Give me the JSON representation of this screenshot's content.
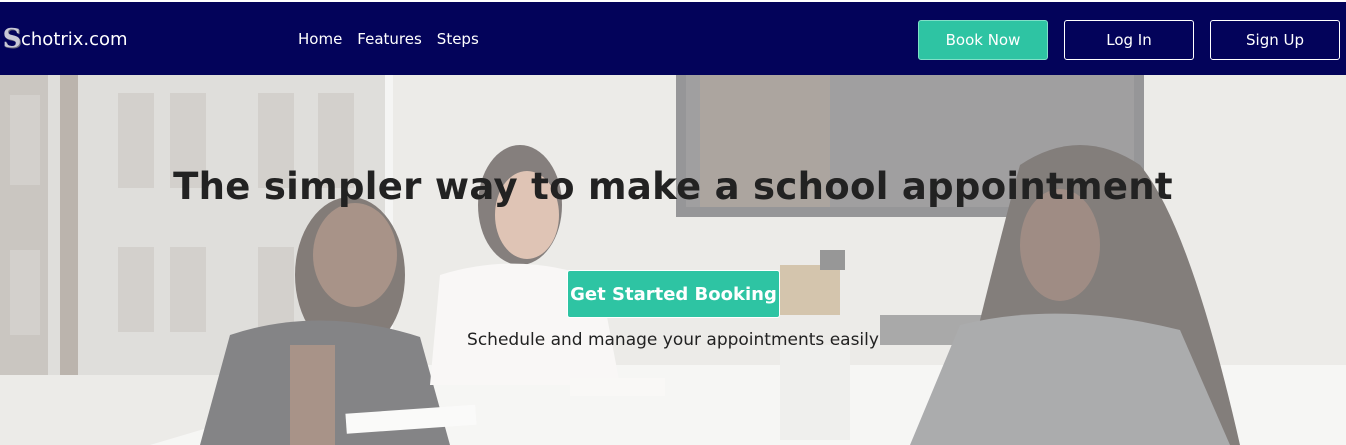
{
  "brand": {
    "mark": "S",
    "name": "chotrix.com"
  },
  "nav": {
    "items": [
      "Home",
      "Features",
      "Steps"
    ]
  },
  "actions": {
    "book_now": "Book Now",
    "log_in": "Log In",
    "sign_up": "Sign Up"
  },
  "hero": {
    "title": "The simpler way to make a school appointment",
    "cta": "Get Started Booking",
    "tagline": "Schedule and manage your appointments easily"
  },
  "colors": {
    "navbar": "#03035a",
    "accent": "#2ec4a3",
    "text": "#222222"
  }
}
